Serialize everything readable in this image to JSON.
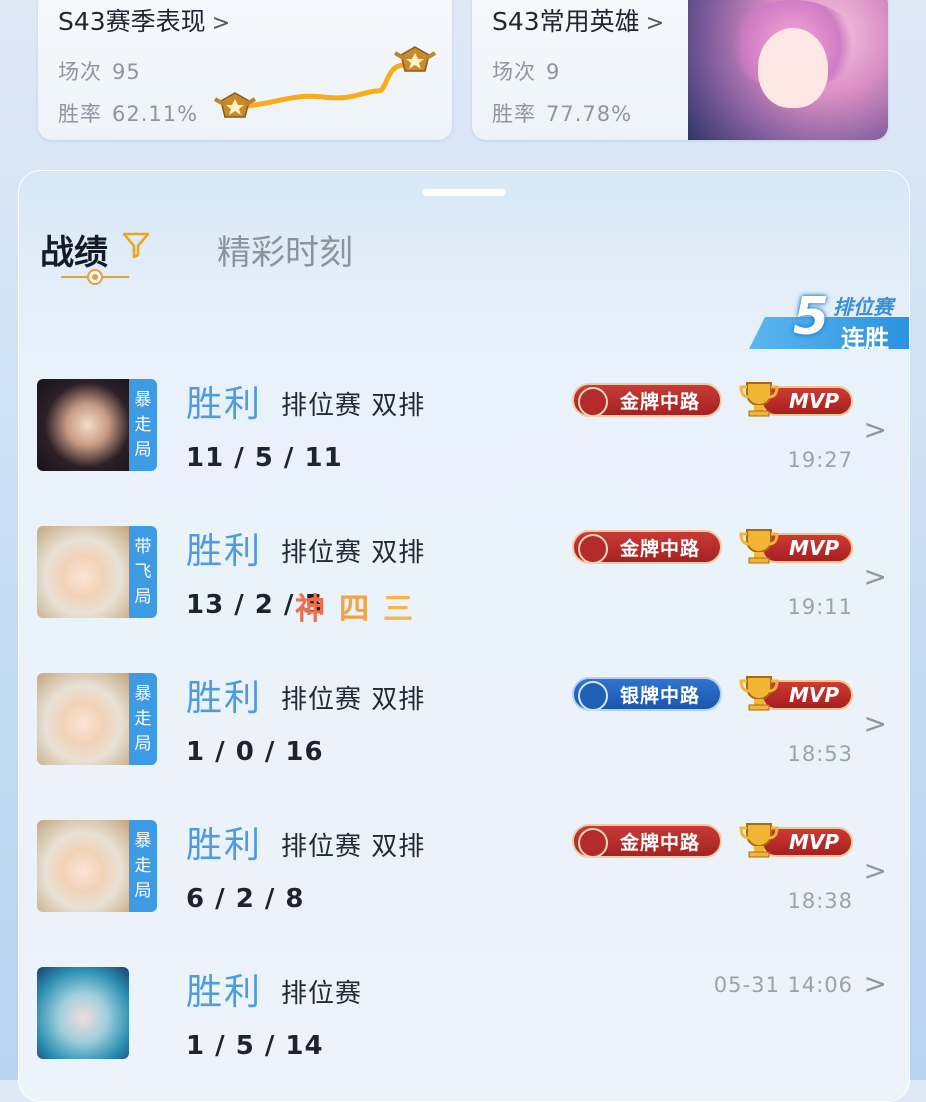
{
  "season_card": {
    "title": "S43赛季表现",
    "matches_label": "场次",
    "matches_value": "95",
    "winrate_label": "胜率",
    "winrate_value": "62.11%"
  },
  "heroes_card": {
    "title": "S43常用英雄",
    "matches_label": "场次",
    "matches_value": "9",
    "winrate_label": "胜率",
    "winrate_value": "77.78%"
  },
  "tabs": {
    "records": "战绩",
    "highlights": "精彩时刻"
  },
  "streak": {
    "count": "5",
    "mode": "排位赛",
    "label": "连胜"
  },
  "chevron": ">",
  "matches": [
    {
      "result": "胜利",
      "mode": "排位赛 双排",
      "kda": "11 / 5 / 11",
      "badge": [
        "暴",
        "走",
        "局"
      ],
      "lane": "金牌中路",
      "lane_tier": "gold",
      "mvp": "MVP",
      "time": "19:27",
      "tags": []
    },
    {
      "result": "胜利",
      "mode": "排位赛 双排",
      "kda": "13 / 2 / 5",
      "badge": [
        "带",
        "飞",
        "局"
      ],
      "lane": "金牌中路",
      "lane_tier": "gold",
      "mvp": "MVP",
      "time": "19:11",
      "tags": [
        "神",
        "四",
        "三"
      ]
    },
    {
      "result": "胜利",
      "mode": "排位赛 双排",
      "kda": "1 / 0 / 16",
      "badge": [
        "暴",
        "走",
        "局"
      ],
      "lane": "银牌中路",
      "lane_tier": "silver",
      "mvp": "MVP",
      "time": "18:53",
      "tags": []
    },
    {
      "result": "胜利",
      "mode": "排位赛 双排",
      "kda": "6 / 2 / 8",
      "badge": [
        "暴",
        "走",
        "局"
      ],
      "lane": "金牌中路",
      "lane_tier": "gold",
      "mvp": "MVP",
      "time": "18:38",
      "tags": []
    },
    {
      "result": "胜利",
      "mode": "排位赛",
      "kda": "1 / 5 / 14",
      "badge": [],
      "lane": "",
      "lane_tier": "",
      "mvp": "",
      "time": "05-31 14:06",
      "tags": []
    }
  ],
  "colors": {
    "win_blue": "#4e9ce0",
    "gold_lane": "#b02a27",
    "silver_lane": "#245fba",
    "badge_blue": "#3e9ae3"
  }
}
